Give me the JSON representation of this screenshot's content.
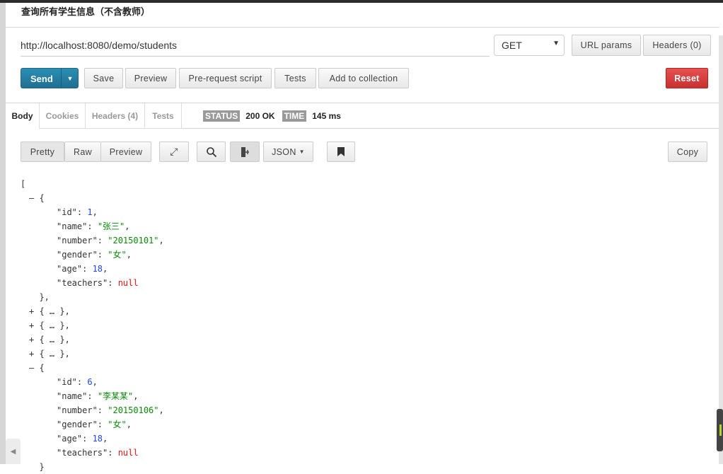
{
  "request": {
    "name": "查询所有学生信息（不含教师）",
    "url": "http://localhost:8080/demo/students",
    "method": "GET",
    "url_params": "URL params",
    "headers": "Headers (0)",
    "send": "Send",
    "save": "Save",
    "preview": "Preview",
    "prerequest": "Pre-request script",
    "tests": "Tests",
    "add_collection": "Add to collection",
    "reset": "Reset"
  },
  "colors": {
    "send": "#2181a8",
    "reset": "#d63c3c",
    "number": "#2244ee",
    "string": "#0a8a0a",
    "null": "#ee1111"
  },
  "response": {
    "tabs": [
      {
        "label": "Body",
        "active": true
      },
      {
        "label": "Cookies"
      },
      {
        "label": "Headers (4)"
      },
      {
        "label": "Tests"
      }
    ],
    "status_label": "STATUS",
    "status": "200 OK",
    "time_label": "TIME",
    "time": "145 ms",
    "view_modes": [
      "Pretty",
      "Raw",
      "Preview"
    ],
    "format": "JSON",
    "copy": "Copy",
    "icons": [
      "expand-icon",
      "search-icon",
      "wrap-icon",
      "bookmark-icon"
    ],
    "lines": [
      {
        "i": 0,
        "text": "["
      },
      {
        "i": 1,
        "text": "— {"
      },
      {
        "i": 2,
        "key": "\"id\"",
        "val": "1",
        "vt": "num"
      },
      {
        "i": 2,
        "key": "\"name\"",
        "val": "\"张三\"",
        "vt": "str"
      },
      {
        "i": 2,
        "key": "\"number\"",
        "val": "\"20150101\"",
        "vt": "str"
      },
      {
        "i": 2,
        "key": "\"gender\"",
        "val": "\"女\"",
        "vt": "str"
      },
      {
        "i": 2,
        "key": "\"age\"",
        "val": "18",
        "vt": "num"
      },
      {
        "i": 2,
        "key": "\"teachers\"",
        "val": "null",
        "vt": "nul",
        "last": true
      },
      {
        "i": 1,
        "text": "  },"
      },
      {
        "i": 1,
        "text": "+ { … },"
      },
      {
        "i": 1,
        "text": "+ { … },"
      },
      {
        "i": 1,
        "text": "+ { … },"
      },
      {
        "i": 1,
        "text": "+ { … },"
      },
      {
        "i": 1,
        "text": "— {"
      },
      {
        "i": 2,
        "key": "\"id\"",
        "val": "6",
        "vt": "num"
      },
      {
        "i": 2,
        "key": "\"name\"",
        "val": "\"李某某\"",
        "vt": "str"
      },
      {
        "i": 2,
        "key": "\"number\"",
        "val": "\"20150106\"",
        "vt": "str"
      },
      {
        "i": 2,
        "key": "\"gender\"",
        "val": "\"女\"",
        "vt": "str"
      },
      {
        "i": 2,
        "key": "\"age\"",
        "val": "18",
        "vt": "num"
      },
      {
        "i": 2,
        "key": "\"teachers\"",
        "val": "null",
        "vt": "nul",
        "last": true
      },
      {
        "i": 1,
        "text": "  }"
      }
    ]
  }
}
